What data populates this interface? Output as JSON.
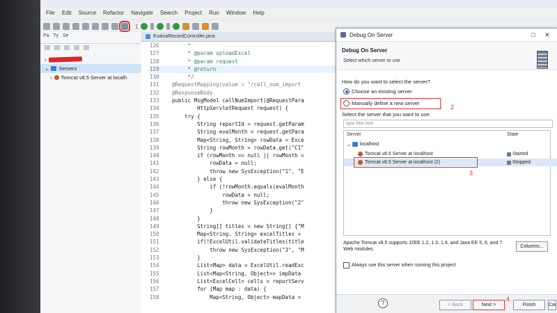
{
  "menu": [
    "File",
    "Edit",
    "Source",
    "Refactor",
    "Navigate",
    "Search",
    "Project",
    "Run",
    "Window",
    "Help"
  ],
  "toolbar": {
    "annotation_number": "1"
  },
  "left_panel": {
    "tabs": [
      "Pa",
      "Ty",
      "Se"
    ],
    "tree": [
      {
        "label": "Servers"
      },
      {
        "label": "Tomcat v8.5 Server at localh"
      }
    ]
  },
  "editor": {
    "tab_label": "EvaluaRecordController.java",
    "lines": [
      {
        "num": "126",
        "text": "     *"
      },
      {
        "num": "127",
        "text": "     * @param uploadExcel"
      },
      {
        "num": "128",
        "text": "     * @param request"
      },
      {
        "num": "129",
        "text": "     * @return"
      },
      {
        "num": "130",
        "text": "     */"
      },
      {
        "num": "131",
        "text": "@RequestMapping(value = \"/call_num_import"
      },
      {
        "num": "132",
        "text": "@ResponseBody"
      },
      {
        "num": "133",
        "text": "public MsgModel callNumImport(@RequestPara"
      },
      {
        "num": "134",
        "text": "        HttpServletRequest request) {"
      },
      {
        "num": "135",
        "text": "    try {"
      },
      {
        "num": "136",
        "text": "        String reportId = request.getParam"
      },
      {
        "num": "137",
        "text": "        String evalMonth = request.getPara"
      },
      {
        "num": "138",
        "text": "        Map<String, String> rowData = Exce"
      },
      {
        "num": "139",
        "text": "        String rowMonth = rowData.get(\"C1\""
      },
      {
        "num": "140",
        "text": "        if (rowMonth == null || rowMonth ="
      },
      {
        "num": "141",
        "text": "            rowData = null;"
      },
      {
        "num": "142",
        "text": "            throw new SysException(\"1\", \"E"
      },
      {
        "num": "143",
        "text": "        } else {"
      },
      {
        "num": "144",
        "text": "            if (!rowMonth.equals(evalMonth"
      },
      {
        "num": "145",
        "text": "                rowData = null;"
      },
      {
        "num": "146",
        "text": "                throw new SysException(\"2\""
      },
      {
        "num": "147",
        "text": "            }"
      },
      {
        "num": "148",
        "text": "        }"
      },
      {
        "num": "149",
        "text": "        String[] titles = new String[] {\"M"
      },
      {
        "num": "150",
        "text": "        Map<String, String> excelTitles ="
      },
      {
        "num": "151",
        "text": "        if(!ExcelUtil.validateTitles(title"
      },
      {
        "num": "152",
        "text": "            throw new SysException(\"3\", \"M"
      },
      {
        "num": "153",
        "text": "        }"
      },
      {
        "num": "154",
        "text": "        List<Map> data = ExcelUtil.readExc"
      },
      {
        "num": "155",
        "text": "        List<Map<String, Object>> impData"
      },
      {
        "num": "156",
        "text": "        List<ExcelCell> cells = reportServ"
      },
      {
        "num": "157",
        "text": "        for (Map map : data) {"
      },
      {
        "num": "158",
        "text": "            Map<String, Object> mapData ="
      }
    ]
  },
  "dialog": {
    "title": "Debug On Server",
    "header_title": "Debug On Server",
    "header_subtitle": "Select which server to use",
    "question": "How do you want to select the server?",
    "option_existing": "Choose an existing server",
    "option_manual": "Manually define a new server",
    "select_label": "Select the server that you want to use:",
    "filter_placeholder": "type filter text",
    "col_server": "Server",
    "col_state": "State",
    "group": "localhost",
    "servers": [
      {
        "name": "Tomcat v8.5 Server at localhost",
        "state": "Started"
      },
      {
        "name": "Tomcat v8.5 Server at localhost (2)",
        "state": "Stopped"
      }
    ],
    "description": "Apache Tomcat v8.5 supports J2EE 1.2, 1.3, 1.4, and Java EE 5, 6, and 7 Web modules.",
    "columns_button": "Columns...",
    "always_use": "Always use this server when running this project",
    "help": "?",
    "back": "< Back",
    "next": "Next >",
    "finish": "Finish",
    "cancel": "Cancel",
    "annot": {
      "n2": "2",
      "n3": "3",
      "n4": "4"
    }
  },
  "colors": {
    "annotation": "#e23232",
    "selection": "#dbe8f7",
    "accent": "#1d5fd1"
  }
}
